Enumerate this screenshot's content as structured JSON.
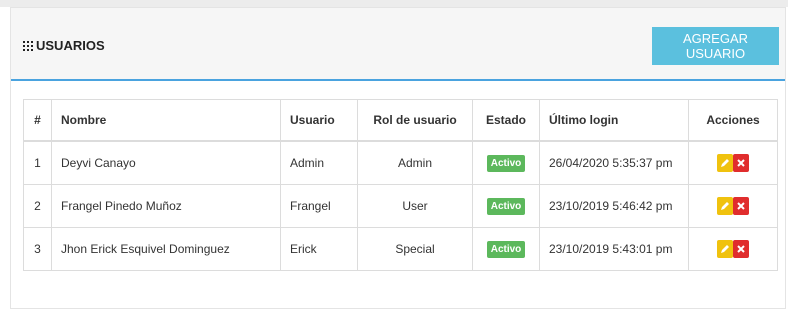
{
  "header": {
    "title": "USUARIOS",
    "add_button_label": "AGREGAR USUARIO"
  },
  "table": {
    "columns": [
      "#",
      "Nombre",
      "Usuario",
      "Rol de usuario",
      "Estado",
      "Último login",
      "Acciones"
    ],
    "rows": [
      {
        "num": "1",
        "nombre": "Deyvi Canayo",
        "usuario": "Admin",
        "rol": "Admin",
        "estado": "Activo",
        "ultimo_login": "26/04/2020 5:35:37 pm"
      },
      {
        "num": "2",
        "nombre": "Frangel Pinedo Muñoz",
        "usuario": "Frangel",
        "rol": "User",
        "estado": "Activo",
        "ultimo_login": "23/10/2019 5:46:42 pm"
      },
      {
        "num": "3",
        "nombre": "Jhon Erick Esquivel Dominguez",
        "usuario": "Erick",
        "rol": "Special",
        "estado": "Activo",
        "ultimo_login": "23/10/2019 5:43:01 pm"
      }
    ]
  },
  "colors": {
    "accent": "#5bc0de",
    "header_border": "#4aa3df",
    "active_badge": "#5cb85c",
    "edit_button": "#f0c20e",
    "delete_button": "#e02d2d"
  },
  "icons": {
    "title_icon": "grid-icon",
    "edit_icon": "pencil-icon",
    "delete_icon": "close-icon"
  }
}
